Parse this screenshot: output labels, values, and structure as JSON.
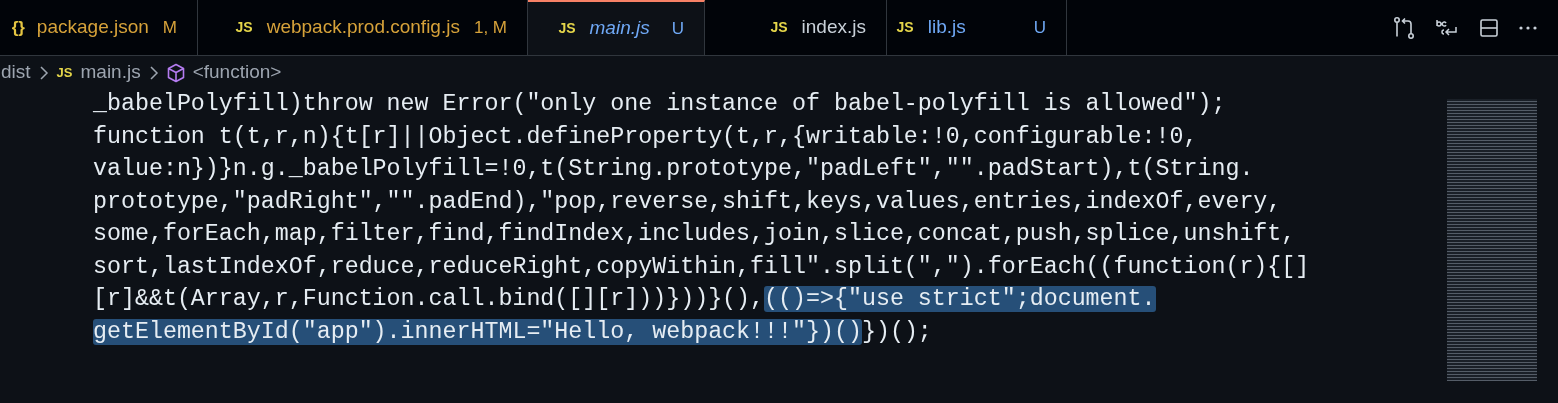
{
  "tabs": [
    {
      "icon": "{}",
      "kind": "json",
      "label": "package.json",
      "status": "M",
      "color": "#d6a23a",
      "selected": false,
      "preview": false
    },
    {
      "icon": "JS",
      "kind": "js",
      "label": "webpack.prod.config.js",
      "status": "1, M",
      "color": "#d6a23a",
      "selected": false,
      "preview": false
    },
    {
      "icon": "JS",
      "kind": "js",
      "label": "main.js",
      "status": "U",
      "color": "#6fa8f5",
      "selected": true,
      "preview": true
    },
    {
      "icon": "JS",
      "kind": "js",
      "label": "index.js",
      "color": "#c9d1d9",
      "selected": false,
      "preview": false
    },
    {
      "icon": "JS",
      "kind": "js",
      "label": "lib.js",
      "status": "U",
      "color": "#6fa8f5",
      "selected": false,
      "preview": false
    }
  ],
  "breadcrumb": [
    {
      "kind": "folder",
      "label": "dist"
    },
    {
      "kind": "js",
      "icon": "JS",
      "label": "main.js"
    },
    {
      "kind": "symbol",
      "label": "<function>"
    }
  ],
  "code_lines": [
    [
      {
        "text": "_babelPolyfill)throw new Error(\"only one instance of babel-polyfill is allowed\");",
        "selected": false
      }
    ],
    [
      {
        "text": "function t(t,r,n){t[r]||Object.defineProperty(t,r,{writable:!0,configurable:!0,",
        "selected": false
      }
    ],
    [
      {
        "text": "value:n})}n.g._babelPolyfill=!0,t(String.prototype,\"padLeft\",\"\".padStart),t(String.",
        "selected": false
      }
    ],
    [
      {
        "text": "prototype,\"padRight\",\"\".padEnd),\"pop,reverse,shift,keys,values,entries,indexOf,every,",
        "selected": false
      }
    ],
    [
      {
        "text": "some,forEach,map,filter,find,findIndex,includes,join,slice,concat,push,splice,unshift,",
        "selected": false
      }
    ],
    [
      {
        "text": "sort,lastIndexOf,reduce,reduceRight,copyWithin,fill\".split(\",\").forEach((function(r){[]",
        "selected": false
      }
    ],
    [
      {
        "text": "[r]&&t(Array,r,Function.call.bind([][r]))}))}(),",
        "selected": false
      },
      {
        "text": "(()=>{\"use strict\";document.",
        "selected": true
      }
    ],
    [
      {
        "text": "getElementById(\"app\").innerHTML=\"Hello, webpack!!!\"})()",
        "selected": true
      },
      {
        "text": "})();",
        "selected": false
      }
    ]
  ]
}
